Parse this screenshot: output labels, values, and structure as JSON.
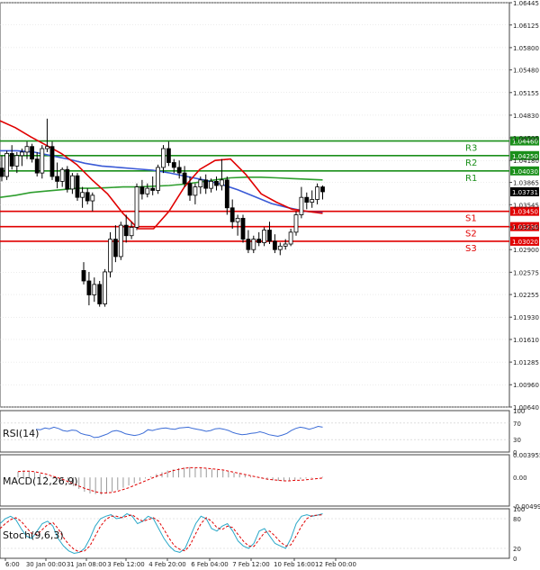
{
  "chart_data": [
    {
      "type": "candlestick",
      "panel": "price",
      "ylim": [
        1.0064,
        1.06445
      ],
      "y_ticks": [
        "1.06445",
        "1.06125",
        "1.05800",
        "1.05480",
        "1.05155",
        "1.04830",
        "1.04505",
        "1.04180",
        "1.03865",
        "1.03545",
        "1.03225",
        "1.02900",
        "1.02575",
        "1.02255",
        "1.01930",
        "1.01610",
        "1.01285",
        "1.00960",
        "1.00640"
      ],
      "x_ticks": [
        "6:00",
        "30 Jan 00:00",
        "31 Jan 08:00",
        "3 Feb 12:00",
        "4 Feb 20:00",
        "6 Feb 04:00",
        "7 Feb 12:00",
        "10 Feb 16:00",
        "12 Feb 00:00"
      ],
      "current_price": "1.03731",
      "levels": [
        {
          "name": "R3",
          "value": 1.0446,
          "label": "1.04460",
          "color": "#1a8f1a"
        },
        {
          "name": "R2",
          "value": 1.0425,
          "label": "1.04250",
          "color": "#1a8f1a"
        },
        {
          "name": "R1",
          "value": 1.0403,
          "label": "1.04030",
          "color": "#1a8f1a"
        },
        {
          "name": "S1",
          "value": 1.0345,
          "label": "1.03450",
          "color": "#e00000"
        },
        {
          "name": "S2",
          "value": 1.0323,
          "label": "1.03230",
          "color": "#e00000"
        },
        {
          "name": "S3",
          "value": 1.0302,
          "label": "1.03020",
          "color": "#e00000"
        }
      ],
      "candles": [
        [
          1.0407,
          1.0425,
          1.0388,
          1.0395
        ],
        [
          1.0395,
          1.0432,
          1.039,
          1.0428
        ],
        [
          1.0428,
          1.044,
          1.0405,
          1.041
        ],
        [
          1.041,
          1.043,
          1.04,
          1.0425
        ],
        [
          1.0425,
          1.0435,
          1.041,
          1.043
        ],
        [
          1.043,
          1.0445,
          1.042,
          1.0438
        ],
        [
          1.0438,
          1.0442,
          1.0415,
          1.042
        ],
        [
          1.042,
          1.043,
          1.0395,
          1.04
        ],
        [
          1.04,
          1.044,
          1.0392,
          1.0435
        ],
        [
          1.0435,
          1.0478,
          1.043,
          1.0438
        ],
        [
          1.0438,
          1.0445,
          1.039,
          1.0395
        ],
        [
          1.0395,
          1.0415,
          1.0378,
          1.0388
        ],
        [
          1.0388,
          1.0408,
          1.038,
          1.0405
        ],
        [
          1.0405,
          1.041,
          1.0372,
          1.0377
        ],
        [
          1.0377,
          1.04,
          1.037,
          1.0396
        ],
        [
          1.0396,
          1.04,
          1.036,
          1.0365
        ],
        [
          1.0365,
          1.038,
          1.035,
          1.0372
        ],
        [
          1.0372,
          1.0378,
          1.0355,
          1.036
        ],
        [
          1.036,
          1.0372,
          1.0345,
          1.0368
        ],
        [
          1.026,
          1.0272,
          1.024,
          1.0245
        ],
        [
          1.0245,
          1.0258,
          1.021,
          1.0225
        ],
        [
          1.0225,
          1.025,
          1.0215,
          1.024
        ],
        [
          1.024,
          1.0245,
          1.0208,
          1.0212
        ],
        [
          1.0212,
          1.0262,
          1.0208,
          1.0258
        ],
        [
          1.0258,
          1.0315,
          1.025,
          1.0305
        ],
        [
          1.0305,
          1.0325,
          1.0272,
          1.028
        ],
        [
          1.028,
          1.033,
          1.0275,
          1.0325
        ],
        [
          1.0325,
          1.034,
          1.03,
          1.031
        ],
        [
          1.031,
          1.033,
          1.0305,
          1.0322
        ],
        [
          1.0322,
          1.0385,
          1.0318,
          1.038
        ],
        [
          1.038,
          1.039,
          1.0362,
          1.037
        ],
        [
          1.037,
          1.0385,
          1.0365,
          1.0378
        ],
        [
          1.0378,
          1.0395,
          1.0368,
          1.0375
        ],
        [
          1.0375,
          1.0412,
          1.037,
          1.0408
        ],
        [
          1.0408,
          1.044,
          1.04,
          1.0435
        ],
        [
          1.0435,
          1.0445,
          1.041,
          1.0415
        ],
        [
          1.0415,
          1.042,
          1.04,
          1.0408
        ],
        [
          1.0408,
          1.0418,
          1.0392,
          1.04
        ],
        [
          1.04,
          1.041,
          1.038,
          1.0385
        ],
        [
          1.0385,
          1.0395,
          1.036,
          1.0368
        ],
        [
          1.0368,
          1.0385,
          1.0355,
          1.038
        ],
        [
          1.038,
          1.0395,
          1.037,
          1.039
        ],
        [
          1.039,
          1.0398,
          1.037,
          1.0378
        ],
        [
          1.0378,
          1.0392,
          1.0372,
          1.0388
        ],
        [
          1.0388,
          1.0395,
          1.0375,
          1.0382
        ],
        [
          1.0382,
          1.042,
          1.0375,
          1.039
        ],
        [
          1.039,
          1.0395,
          1.034,
          1.035
        ],
        [
          1.035,
          1.0362,
          1.032,
          1.033
        ],
        [
          1.033,
          1.034,
          1.031,
          1.0335
        ],
        [
          1.0335,
          1.034,
          1.03,
          1.0305
        ],
        [
          1.0305,
          1.0318,
          1.0285,
          1.029
        ],
        [
          1.029,
          1.031,
          1.0285,
          1.0305
        ],
        [
          1.0305,
          1.0315,
          1.0295,
          1.03
        ],
        [
          1.03,
          1.0322,
          1.0295,
          1.0318
        ],
        [
          1.0318,
          1.033,
          1.0298,
          1.0302
        ],
        [
          1.0302,
          1.0312,
          1.0285,
          1.029
        ],
        [
          1.029,
          1.03,
          1.0282,
          1.0295
        ],
        [
          1.0295,
          1.0305,
          1.029,
          1.0298
        ],
        [
          1.0298,
          1.032,
          1.0295,
          1.0315
        ],
        [
          1.0315,
          1.0345,
          1.031,
          1.034
        ],
        [
          1.034,
          1.038,
          1.0335,
          1.0365
        ],
        [
          1.0365,
          1.0372,
          1.0348,
          1.0358
        ],
        [
          1.0358,
          1.0375,
          1.035,
          1.0362
        ],
        [
          1.0362,
          1.0385,
          1.0355,
          1.038
        ],
        [
          1.038,
          1.0382,
          1.0362,
          1.0373
        ]
      ],
      "ma_slow": [
        1.0365,
        1.0368,
        1.0372,
        1.0374,
        1.0376,
        1.0378,
        1.0378,
        1.0379,
        1.038,
        1.038,
        1.0381,
        1.0382,
        1.0384,
        1.0387,
        1.039,
        1.0393,
        1.0394,
        1.0394,
        1.0393,
        1.0392,
        1.0391,
        1.039
      ],
      "ma_blue": [
        1.0432,
        1.0432,
        1.043,
        1.0425,
        1.042,
        1.0414,
        1.041,
        1.0408,
        1.0406,
        1.0404,
        1.04,
        1.0395,
        1.039,
        1.0384,
        1.0376,
        1.0366,
        1.0356,
        1.035,
        1.0345,
        1.0343
      ],
      "ma_fast": [
        1.0475,
        1.0465,
        1.0452,
        1.044,
        1.0428,
        1.0412,
        1.039,
        1.037,
        1.0342,
        1.032,
        1.032,
        1.0345,
        1.038,
        1.0405,
        1.0418,
        1.042,
        1.0398,
        1.037,
        1.0358,
        1.0348,
        1.0345,
        1.0342
      ],
      "series_colors": {
        "ma_slow": "#2e9e2e",
        "ma_blue": "#3a5ad6",
        "ma_fast": "#e00000"
      }
    },
    {
      "type": "line",
      "panel": "rsi",
      "label": "RSI(14)",
      "ylim": [
        0,
        100
      ],
      "y_ticks": [
        "100",
        "70",
        "30",
        "0"
      ],
      "values": [
        55,
        54,
        58,
        56,
        60,
        57,
        52,
        50,
        53,
        52,
        45,
        42,
        40,
        35,
        36,
        40,
        44,
        50,
        52,
        49,
        44,
        42,
        40,
        42,
        46,
        54,
        52,
        55,
        57,
        58,
        56,
        55,
        58,
        59,
        60,
        57,
        55,
        53,
        50,
        52,
        56,
        57,
        55,
        52,
        47,
        44,
        42,
        43,
        45,
        46,
        49,
        46,
        42,
        40,
        38,
        41,
        45,
        52,
        57,
        60,
        58,
        55,
        58,
        62,
        60
      ],
      "color": "#3a6bd6"
    },
    {
      "type": "bar",
      "panel": "macd",
      "label": "MACD(12,26,9)",
      "ylim": [
        -0.00499,
        0.003955
      ],
      "y_ticks": [
        "0.003955",
        "0.00",
        "-0.00499"
      ],
      "histogram": [
        0.001,
        0.0012,
        0.0011,
        0.0009,
        0.0006,
        0.0003,
        0.0001,
        -0.0002,
        -0.0006,
        -0.001,
        -0.0015,
        -0.002,
        -0.0025,
        -0.0028,
        -0.0029,
        -0.003,
        -0.0028,
        -0.0025,
        -0.0022,
        -0.0018,
        -0.0014,
        -0.001,
        -0.0006,
        -0.0002,
        0.0002,
        0.0006,
        0.0009,
        0.0012,
        0.0014,
        0.0016,
        0.0017,
        0.0018,
        0.0017,
        0.0016,
        0.0015,
        0.0014,
        0.0013,
        0.0012,
        0.001,
        0.0008,
        0.0006,
        0.0004,
        0.0002,
        0.0,
        -0.0002,
        -0.0004,
        -0.0005,
        -0.0006,
        -0.0006,
        -0.0005,
        -0.0004,
        -0.0003,
        -0.0002,
        -0.0001,
        0.0,
        0.0001
      ],
      "signal": [
        0.001,
        0.0011,
        0.0011,
        0.001,
        0.0008,
        0.0006,
        0.0003,
        0.0,
        -0.0003,
        -0.0007,
        -0.0011,
        -0.0015,
        -0.0019,
        -0.0022,
        -0.0025,
        -0.0027,
        -0.0027,
        -0.0026,
        -0.0024,
        -0.0021,
        -0.0018,
        -0.0014,
        -0.001,
        -0.0006,
        -0.0002,
        0.0002,
        0.0005,
        0.0009,
        0.0012,
        0.0014,
        0.0016,
        0.0017,
        0.0017,
        0.0017,
        0.0016,
        0.0015,
        0.0014,
        0.0013,
        0.0011,
        0.0009,
        0.0007,
        0.0005,
        0.0003,
        0.0001,
        -0.0001,
        -0.0003,
        -0.0004,
        -0.0005,
        -0.0006,
        -0.0006,
        -0.0005,
        -0.0005,
        -0.0004,
        -0.0003,
        -0.0002,
        -0.0001
      ],
      "colors": {
        "histogram": "#999999",
        "signal": "#e00000"
      }
    },
    {
      "type": "line",
      "panel": "stoch",
      "label": "Stoch(9,6,3)",
      "ylim": [
        0,
        100
      ],
      "y_ticks": [
        "100",
        "80",
        "20",
        "0"
      ],
      "k": [
        70,
        80,
        85,
        78,
        60,
        45,
        40,
        55,
        70,
        75,
        65,
        40,
        25,
        15,
        10,
        12,
        20,
        40,
        65,
        80,
        85,
        88,
        80,
        82,
        90,
        85,
        70,
        75,
        85,
        80,
        60,
        40,
        25,
        15,
        12,
        20,
        45,
        70,
        85,
        80,
        60,
        55,
        65,
        70,
        55,
        35,
        25,
        20,
        30,
        55,
        60,
        45,
        30,
        25,
        20,
        40,
        70,
        85,
        88,
        85,
        87,
        90
      ],
      "d": [
        60,
        70,
        78,
        82,
        75,
        62,
        50,
        48,
        58,
        68,
        72,
        60,
        42,
        28,
        18,
        13,
        15,
        25,
        45,
        65,
        78,
        85,
        85,
        82,
        85,
        88,
        80,
        75,
        78,
        82,
        75,
        58,
        40,
        25,
        18,
        15,
        28,
        50,
        70,
        82,
        75,
        62,
        58,
        65,
        62,
        48,
        35,
        25,
        24,
        38,
        52,
        55,
        45,
        33,
        25,
        27,
        45,
        65,
        80,
        86,
        87,
        88
      ],
      "colors": {
        "k": "#2aa8c8",
        "d": "#e00000"
      }
    }
  ]
}
